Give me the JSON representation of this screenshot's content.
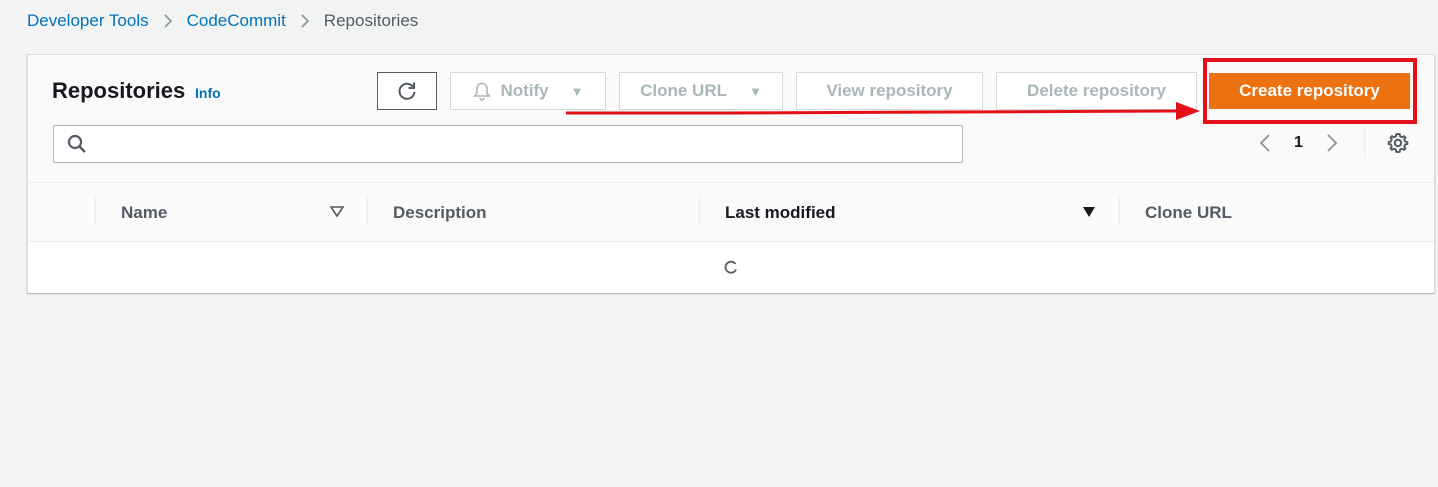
{
  "breadcrumb": {
    "items": [
      "Developer Tools",
      "CodeCommit",
      "Repositories"
    ]
  },
  "header": {
    "title": "Repositories",
    "info_label": "Info"
  },
  "toolbar": {
    "notify_label": "Notify",
    "clone_url_label": "Clone URL",
    "view_label": "View repository",
    "delete_label": "Delete repository",
    "create_label": "Create repository"
  },
  "search": {
    "value": "",
    "placeholder": ""
  },
  "pagination": {
    "current_page": "1"
  },
  "table": {
    "columns": [
      "Name",
      "Description",
      "Last modified",
      "Clone URL"
    ],
    "sorted_column": "Last modified",
    "sort_direction": "descending",
    "rows": [],
    "loading": true
  },
  "colors": {
    "primary_button": "#ec7211",
    "link": "#0073bb",
    "annotation": "#e3101a"
  },
  "icons": {
    "refresh": "refresh-icon",
    "notify": "bell-icon",
    "search": "search-icon",
    "settings": "gear-icon",
    "prev": "chevron-left-icon",
    "next": "chevron-right-icon"
  }
}
